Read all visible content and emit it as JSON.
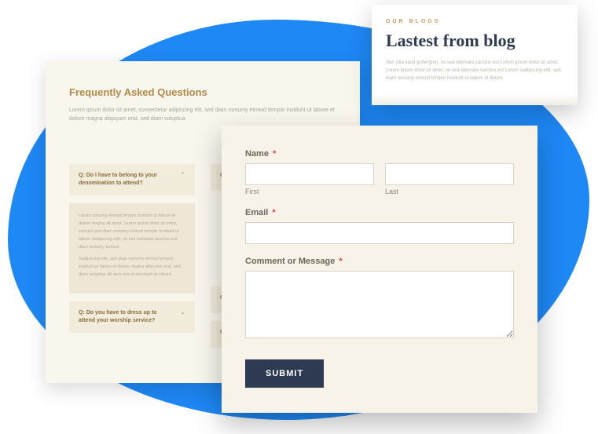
{
  "faq": {
    "title": "Frequently Asked Questions",
    "desc": "Lorem ipsum dolor sit amet, consectetur adipiscing elit, sed diam nonumy eirmod tempor invidunt ut labore et dolore magna aliquyam erat, sed diam voluptua.",
    "items": [
      {
        "q": "Q: Do I have to belong to your denomination to attend?",
        "open": true,
        "a1": "Lorem nonumy eirmod tempor invidunt ut labore et dolore magna sit amet. Lorem ipsum dolor sit amet, sanctus sed diam nonumy eirmod tempor invidunt ut labore sadipscing elitr, no sea takimata sanctus sed diam nonumy eirmod.",
        "a2": "Sadipscing elitr, sed diam nonumy eirmod tempor invidunt ut labore et dolore magna aliquyam erat, sed diam voluptua. At vero eos et accusam et rebum."
      },
      {
        "q": "Q: Do you have to dress up to attend your worship service?",
        "open": false
      }
    ],
    "col2": [
      "Q:",
      "Q:",
      "Q:"
    ]
  },
  "blog": {
    "eyebrow": "OUR BLOGS",
    "title": "Lastest from blog",
    "desc": "Stet clita kasd gubergren, no sea takimata sanctus est Lorem ipsum dolor sit amet. Lorem ipsum dolor sit amet, no sea takimata sanctus est Lorem sadipscing elitr, sed diam nonumy eirmod tempor invidunt ut labore et dolore"
  },
  "form": {
    "name_label": "Name",
    "first": "First",
    "last": "Last",
    "email_label": "Email",
    "message_label": "Comment or Message",
    "submit": "SUBMIT",
    "req": "*"
  }
}
